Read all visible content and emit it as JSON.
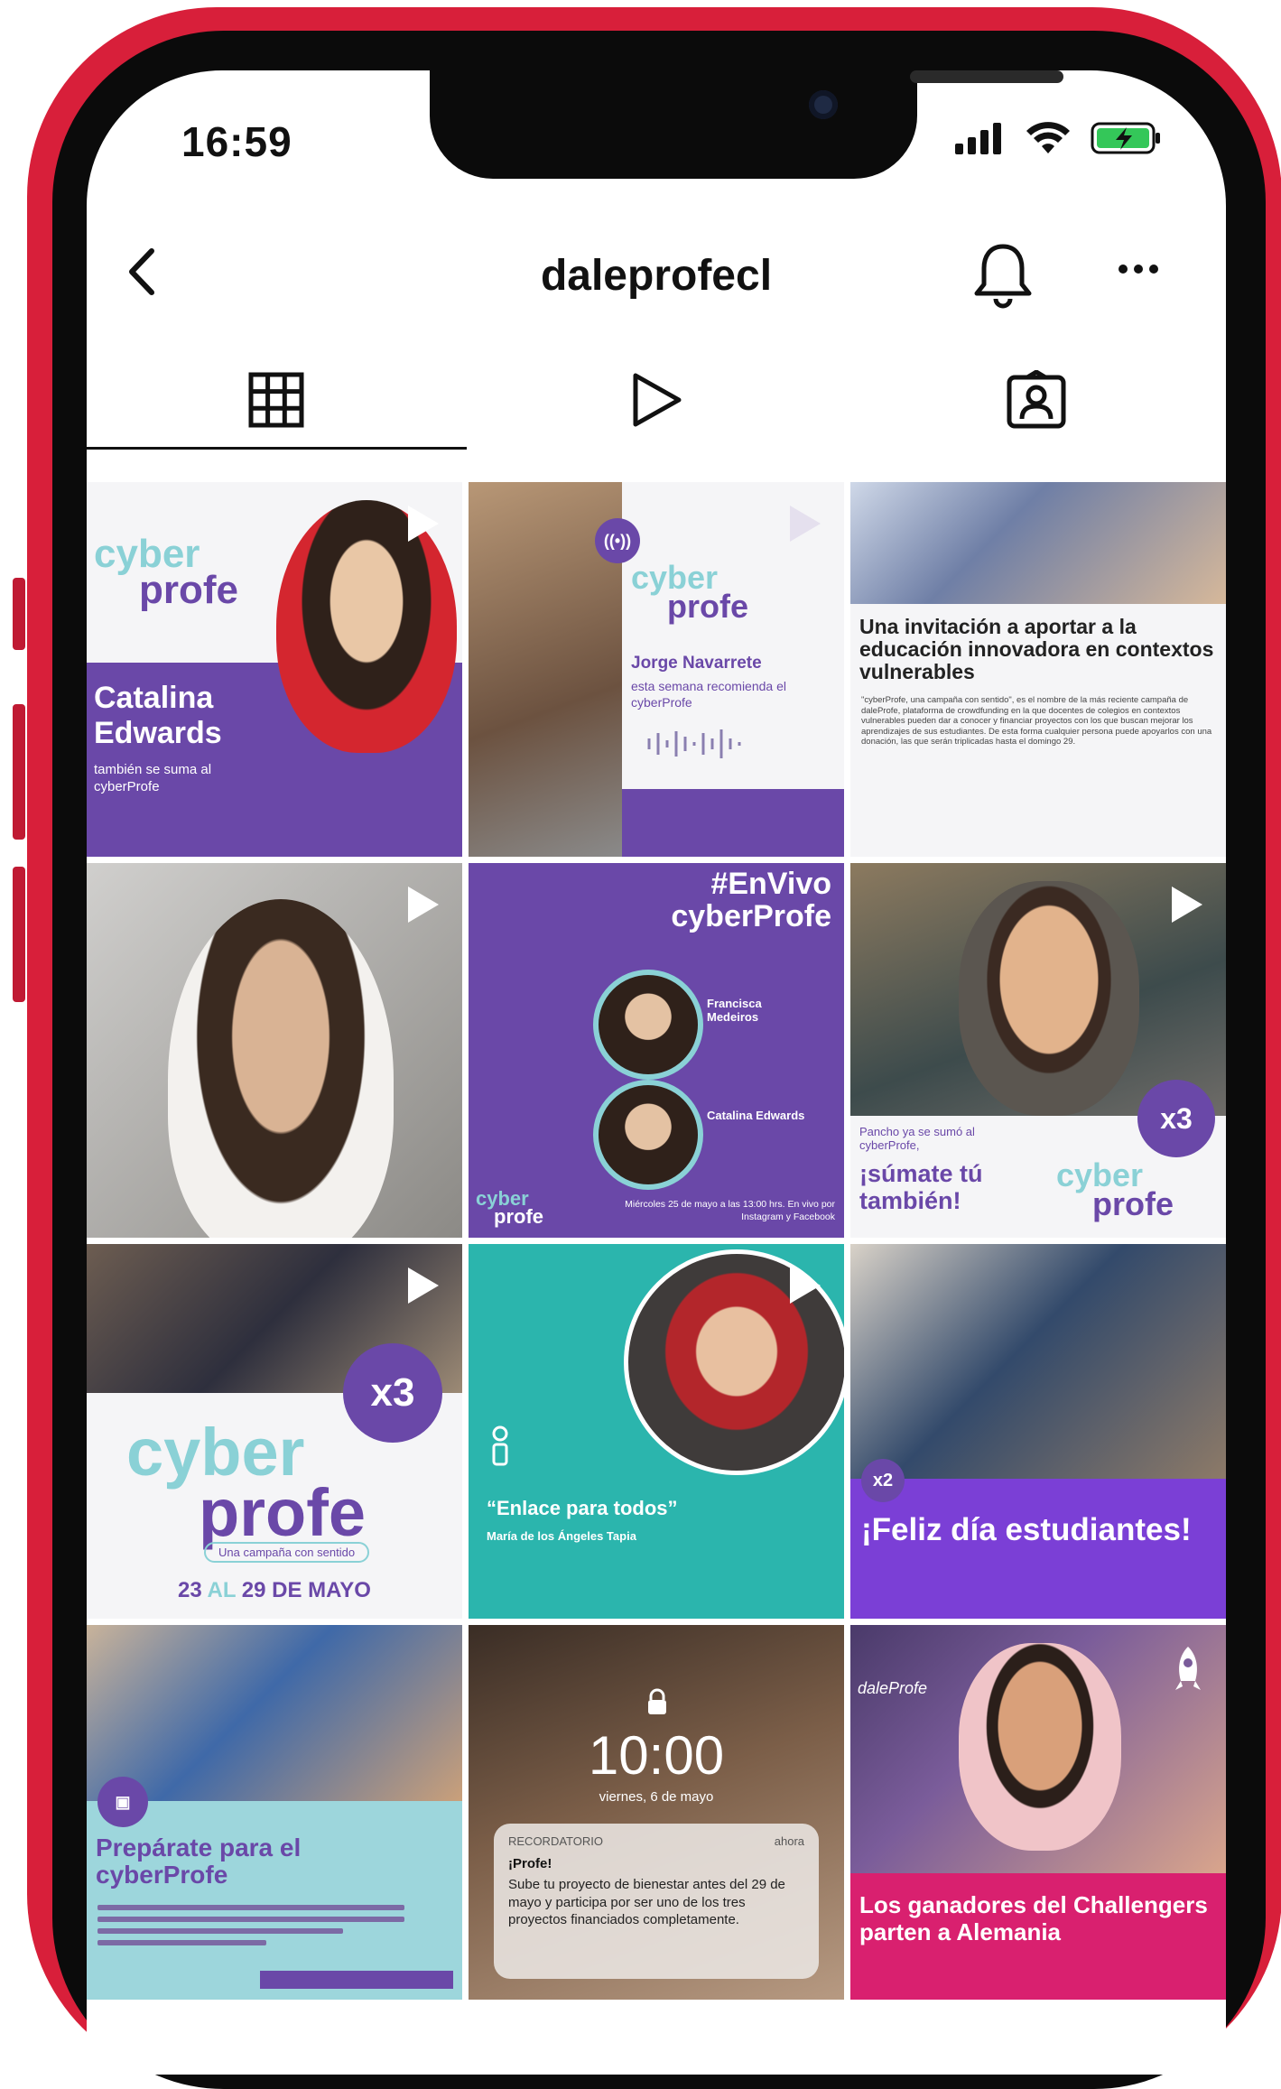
{
  "status": {
    "time": "16:59"
  },
  "nav": {
    "title": "daleprofecl"
  },
  "posts": [
    {
      "id": "p1",
      "heading": "Catalina Edwards",
      "sub": "también se suma al cyberProfe",
      "logo_top": "cyber",
      "logo_bottom": "profe"
    },
    {
      "id": "p2",
      "logo_top": "cyber",
      "logo_bottom": "profe",
      "heading": "Jorge Navarrete",
      "sub": "esta semana recomienda el cyberProfe"
    },
    {
      "id": "p3",
      "heading": "Una invitación a aportar a la educación innovadora en contextos vulnerables",
      "body": "\"cyberProfe, una campaña con sentido\", es el nombre de la más reciente campaña de daleProfe, plataforma de crowdfunding en la que docentes de colegios en contextos vulnerables pueden dar a conocer y financiar proyectos con los que buscan mejorar los aprendizajes de sus estudiantes. De esta forma cualquier persona puede apoyarlos con una donación, las que serán triplicadas hasta el domingo 29."
    },
    {
      "id": "p4"
    },
    {
      "id": "p5",
      "heading": "#EnVivo cyberProfe",
      "guest1": "Francisca Medeiros",
      "guest2": "Catalina Edwards",
      "logo_top": "cyber",
      "logo_bottom": "profe",
      "footer": "Miércoles 25 de mayo a las 13:00 hrs. En vivo por Instagram y Facebook"
    },
    {
      "id": "p6",
      "badge": "x3",
      "sub": "Pancho ya se sumó al cyberProfe,",
      "heading": "¡súmate tú también!",
      "logo_top": "cyber",
      "logo_bottom": "profe"
    },
    {
      "id": "p7",
      "badge": "x3",
      "logo_top": "cyber",
      "logo_bottom": "profe",
      "tagline": "Una campaña con sentido",
      "dates_a": "23 ",
      "dates_b": "AL",
      "dates_c": " 29 DE MAYO"
    },
    {
      "id": "p8",
      "heading": "“Enlace para todos”",
      "name": "María de los Ángeles Tapia"
    },
    {
      "id": "p9",
      "badge": "x2",
      "heading": "¡Feliz día estudiantes!"
    },
    {
      "id": "p10",
      "heading": "Prepárate para el cyberProfe"
    },
    {
      "id": "p11",
      "clock": "10:00",
      "date": "viernes, 6 de mayo",
      "notif_title": "RECORDATORIO",
      "notif_time": "ahora",
      "notif_head": "¡Profe!",
      "notif_body": "Sube tu proyecto de bienestar antes del 29 de mayo y participa por ser uno de los tres proyectos financiados completamente."
    },
    {
      "id": "p12",
      "brand": "daleProfe",
      "heading": "Los ganadores del Challengers parten a Alemania"
    }
  ],
  "colors": {
    "purple": "#6a48a8",
    "teal": "#2bb5ad",
    "violet": "#7b3fd6",
    "pink": "#d9206f",
    "frame": "#d81f3a"
  }
}
